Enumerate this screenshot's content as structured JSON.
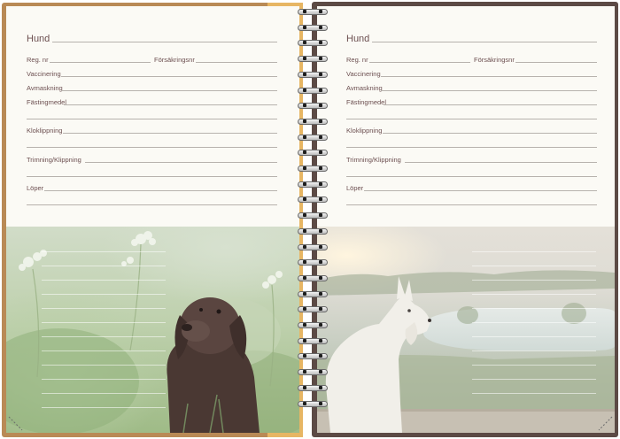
{
  "left_page": {
    "title": "Hund",
    "reg_nr": "Reg. nr",
    "forsakringsnr": "Försäkringsnr",
    "vaccinering": "Vaccinering",
    "avmaskning": "Avmaskning",
    "fastingmedel": "Fästingmedel",
    "kloklippning": "Kloklippning",
    "trimning": "Trimning/Klippning",
    "loper": "Löper",
    "photo_icon": "chocolate-labrador-photo"
  },
  "right_page": {
    "title": "Hund",
    "reg_nr": "Reg. nr",
    "forsakringsnr": "Försäkringsnr",
    "vaccinering": "Vaccinering",
    "avmaskning": "Avmaskning",
    "fastingmedel": "Fästingmedel",
    "kloklippning": "Kloklippning",
    "trimning": "Trimning/Klippning",
    "loper": "Löper",
    "photo_icon": "white-schnauzer-photo"
  },
  "colors": {
    "label_text": "#6c4f50",
    "rule": "#b7b2ad",
    "cover_left": "#e7b664",
    "cover_right": "#5c4a45",
    "paper": "#fbfaf5"
  }
}
